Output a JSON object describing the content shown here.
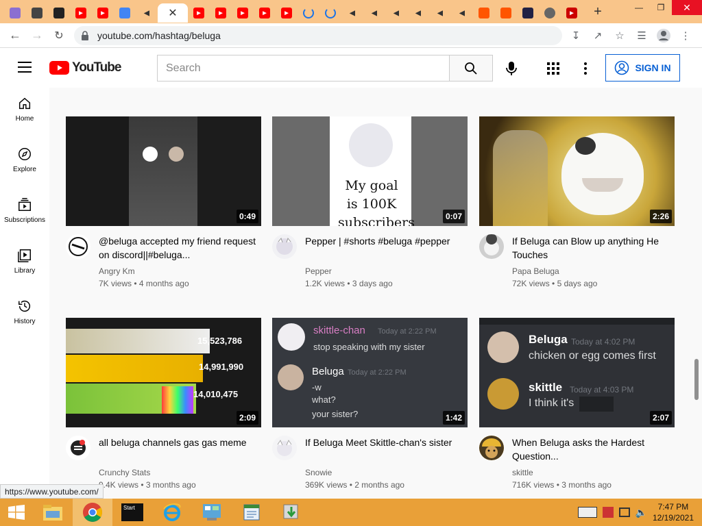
{
  "browser": {
    "tabs": [
      {
        "icon": "layers-icon",
        "color": "#8b6fd1"
      },
      {
        "icon": "app-icon",
        "color": "#444444"
      },
      {
        "icon": "circle-app-icon",
        "color": "#222222"
      },
      {
        "icon": "youtube-icon",
        "color": "#ff0000"
      },
      {
        "icon": "youtube-icon",
        "color": "#ff0000"
      },
      {
        "icon": "photos-icon",
        "color": "#4285f4"
      },
      {
        "icon": "audio-icon",
        "color": "#333333"
      },
      {
        "icon": "youtube-icon",
        "color": "#ff0000"
      },
      {
        "icon": "youtube-icon",
        "color": "#ff0000"
      },
      {
        "icon": "youtube-icon",
        "color": "#ff0000"
      },
      {
        "icon": "youtube-icon",
        "color": "#ff0000"
      },
      {
        "icon": "youtube-icon",
        "color": "#ff0000"
      },
      {
        "icon": "loading-icon",
        "color": "#1a73e8"
      },
      {
        "icon": "loading-icon",
        "color": "#1a73e8"
      },
      {
        "icon": "audio-icon",
        "color": "#333333"
      },
      {
        "icon": "audio-icon",
        "color": "#333333"
      },
      {
        "icon": "audio-icon",
        "color": "#333333"
      },
      {
        "icon": "audio-icon",
        "color": "#333333"
      },
      {
        "icon": "audio-icon",
        "color": "#333333"
      },
      {
        "icon": "audio-icon",
        "color": "#333333"
      },
      {
        "icon": "soundcloud-icon",
        "color": "#ff5500"
      },
      {
        "icon": "soundcloud-icon",
        "color": "#ff5500"
      },
      {
        "icon": "app-icon",
        "color": "#222244"
      },
      {
        "icon": "globe-icon",
        "color": "#666666"
      },
      {
        "icon": "youtube-icon",
        "color": "#cc0000"
      }
    ],
    "active_tab_close": "✕",
    "new_tab": "+",
    "url": "youtube.com/hashtag/beluga",
    "status_url": "https://www.youtube.com/"
  },
  "youtube": {
    "wordmark": "YouTube",
    "search_placeholder": "Search",
    "signin_label": "SIGN IN",
    "brand_red": "#ff0000",
    "accent_blue": "#065fd4"
  },
  "sidebar": {
    "items": [
      {
        "label": "Home",
        "icon": "home-icon"
      },
      {
        "label": "Explore",
        "icon": "compass-icon"
      },
      {
        "label": "Subscriptions",
        "icon": "subscriptions-icon"
      },
      {
        "label": "Library",
        "icon": "library-icon"
      },
      {
        "label": "History",
        "icon": "history-icon"
      }
    ]
  },
  "videos": [
    {
      "title": "@beluga accepted my friend request on discord||#beluga...",
      "channel": "Angry Km",
      "views": "7K views",
      "age": "4 months ago",
      "duration": "0:49"
    },
    {
      "title": "Pepper | #shorts #beluga #pepper",
      "channel": "Pepper",
      "views": "1.2K views",
      "age": "3 days ago",
      "duration": "0:07",
      "thumb_text": "My goal is 100K subscribers"
    },
    {
      "title": "If Beluga can Blow up anything He Touches",
      "channel": "Papa Beluga",
      "views": "72K views",
      "age": "5 days ago",
      "duration": "2:26"
    },
    {
      "title": "all beluga channels gas gas meme",
      "channel": "Crunchy Stats",
      "views": "9.4K views",
      "age": "3 months ago",
      "duration": "2:09",
      "thumb_values": [
        "15,523,786",
        "14,991,990",
        "14,010,475"
      ]
    },
    {
      "title": "If Beluga Meet Skittle-chan's sister",
      "channel": "Snowie",
      "views": "369K views",
      "age": "2 months ago",
      "duration": "1:42",
      "thumb_chat": {
        "name1": "skittle-chan",
        "time1": "Today at 2:22 PM",
        "msg1": "stop speaking with my sister",
        "name2": "Beluga",
        "time2": "Today at 2:22 PM",
        "msg2a": "-w",
        "msg2b": "what?",
        "msg2c": "your sister?"
      }
    },
    {
      "title": "When Beluga asks the Hardest Question...",
      "channel": "skittle",
      "views": "716K views",
      "age": "3 months ago",
      "duration": "2:07",
      "thumb_chat": {
        "name1": "Beluga",
        "time1": "Today at 4:02 PM",
        "msg1": "chicken or egg comes first",
        "name2": "skittle",
        "time2": "Today at 4:03 PM",
        "msg2": "I think it's"
      }
    }
  ],
  "taskbar": {
    "time": "7:47 PM",
    "date": "12/19/2021",
    "start_label": "Start"
  }
}
